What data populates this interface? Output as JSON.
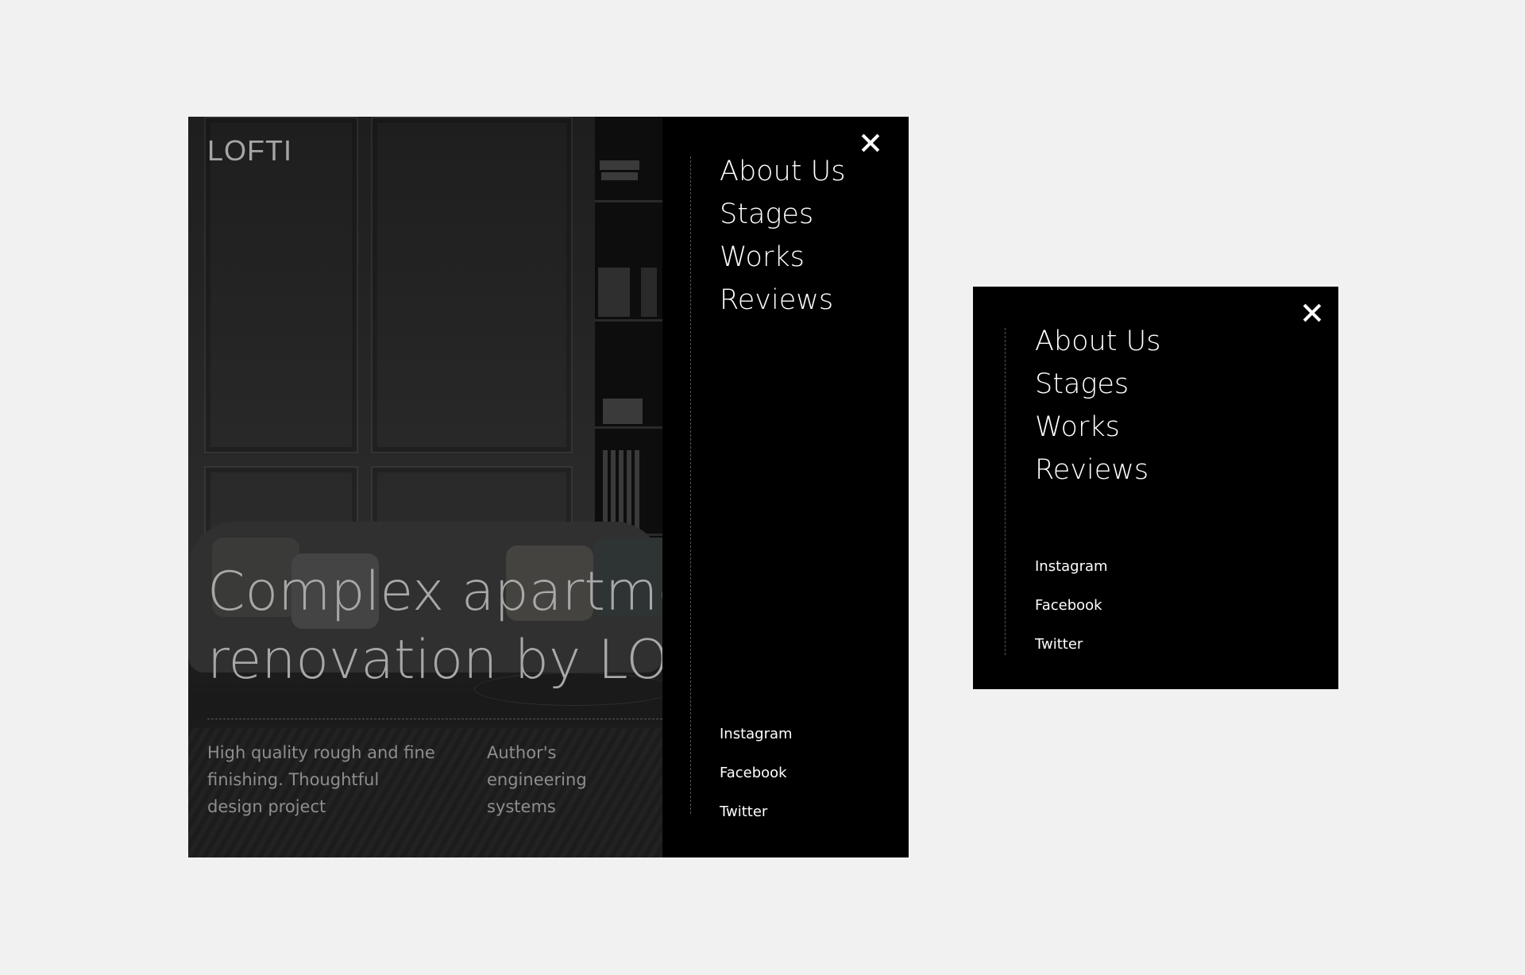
{
  "brand": {
    "logo_text": "LOFTI"
  },
  "hero": {
    "title_line1": "Complex apartment",
    "title_line2": "renovation by LOFTI",
    "features": [
      {
        "text": "High quality rough and fine finishing. Thoughtful design project"
      },
      {
        "text": "Author's engineering systems"
      }
    ]
  },
  "menu": {
    "close_icon": "close-icon",
    "nav_items": [
      {
        "label": "About Us"
      },
      {
        "label": "Stages"
      },
      {
        "label": "Works"
      },
      {
        "label": "Reviews"
      }
    ],
    "social_items": [
      {
        "label": "Instagram"
      },
      {
        "label": "Facebook"
      },
      {
        "label": "Twitter"
      }
    ]
  },
  "colors": {
    "canvas_background": "#f1f1f1",
    "menu_background": "#000000",
    "menu_text": "#ffffff",
    "hero_text": "#a8a8a8"
  }
}
